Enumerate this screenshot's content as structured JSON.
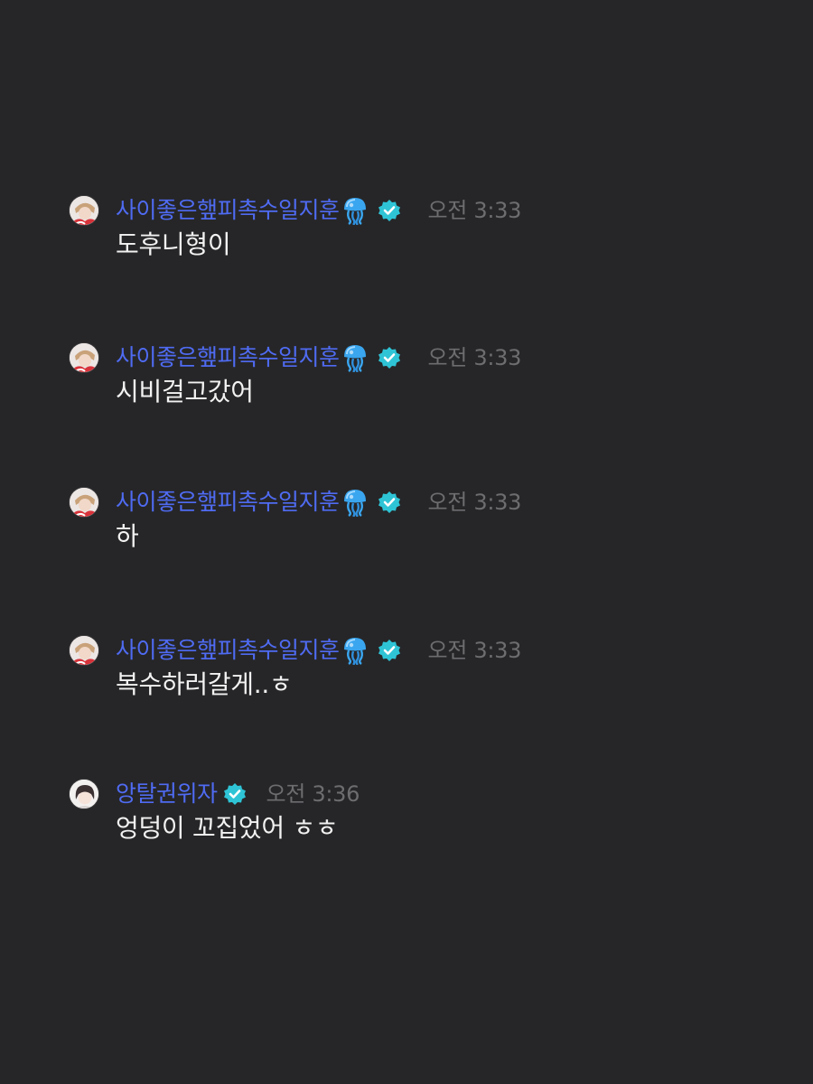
{
  "messages": [
    {
      "username": "사이좋은햎피촉수일지훈",
      "emoji_icon": "jellyfish-icon",
      "verified_icon": "verified-badge-icon",
      "time": "오전 3:33",
      "text": "도후니형이",
      "avatar": "user-avatar-red"
    },
    {
      "username": "사이좋은햎피촉수일지훈",
      "emoji_icon": "jellyfish-icon",
      "verified_icon": "verified-badge-icon",
      "time": "오전 3:33",
      "text": "시비걸고갔어",
      "avatar": "user-avatar-red"
    },
    {
      "username": "사이좋은햎피촉수일지훈",
      "emoji_icon": "jellyfish-icon",
      "verified_icon": "verified-badge-icon",
      "time": "오전 3:33",
      "text": "하",
      "avatar": "user-avatar-red"
    },
    {
      "username": "사이좋은햎피촉수일지훈",
      "emoji_icon": "jellyfish-icon",
      "verified_icon": "verified-badge-icon",
      "time": "오전 3:33",
      "text": "복수하러갈게..ㅎ",
      "avatar": "user-avatar-red"
    },
    {
      "username": "앙탈권위자",
      "verified_icon": "verified-badge-icon",
      "time": "오전 3:36",
      "text": "엉덩이 꼬집었어 ㅎㅎ",
      "avatar": "user-avatar-light"
    }
  ],
  "colors": {
    "background": "#262628",
    "username": "#4f6bf2",
    "timestamp": "#6d6d70",
    "message_text": "#f2f2f2",
    "verified_badge": "#2ec4d6"
  }
}
